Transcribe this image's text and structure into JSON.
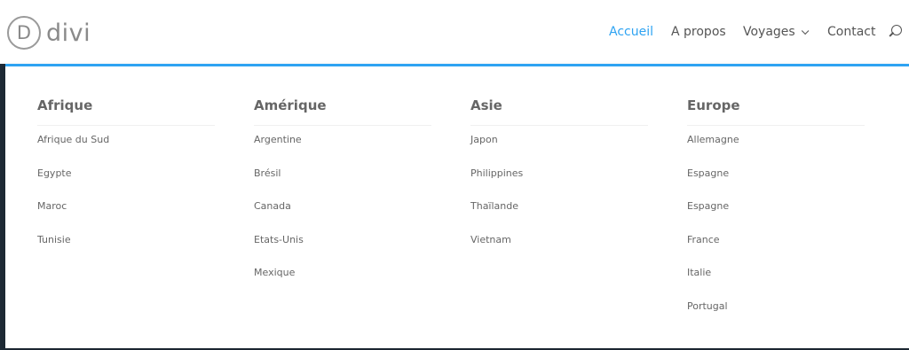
{
  "brand": {
    "logo_letter": "D",
    "logo_text": "divi"
  },
  "nav": {
    "items": [
      {
        "label": "Accueil"
      },
      {
        "label": "A propos"
      },
      {
        "label": "Voyages"
      },
      {
        "label": "Contact"
      }
    ],
    "active": "Accueil",
    "search_icon": "search-icon",
    "dropdown_icon": "chevron-down-icon"
  },
  "colors": {
    "accent": "#2ea3f2",
    "text": "#666666",
    "nav_text": "#555555"
  },
  "mega_menu": {
    "columns": [
      {
        "title": "Afrique",
        "items": [
          "Afrique du Sud",
          "Egypte",
          "Maroc",
          "Tunisie"
        ]
      },
      {
        "title": "Amérique",
        "items": [
          "Argentine",
          "Brésil",
          "Canada",
          "Etats-Unis",
          "Mexique"
        ]
      },
      {
        "title": "Asie",
        "items": [
          "Japon",
          "Philippines",
          "Thaïlande",
          "Vietnam"
        ]
      },
      {
        "title": "Europe",
        "items": [
          "Allemagne",
          "Espagne",
          "Espagne",
          "France",
          "Italie",
          "Portugal"
        ]
      }
    ]
  }
}
